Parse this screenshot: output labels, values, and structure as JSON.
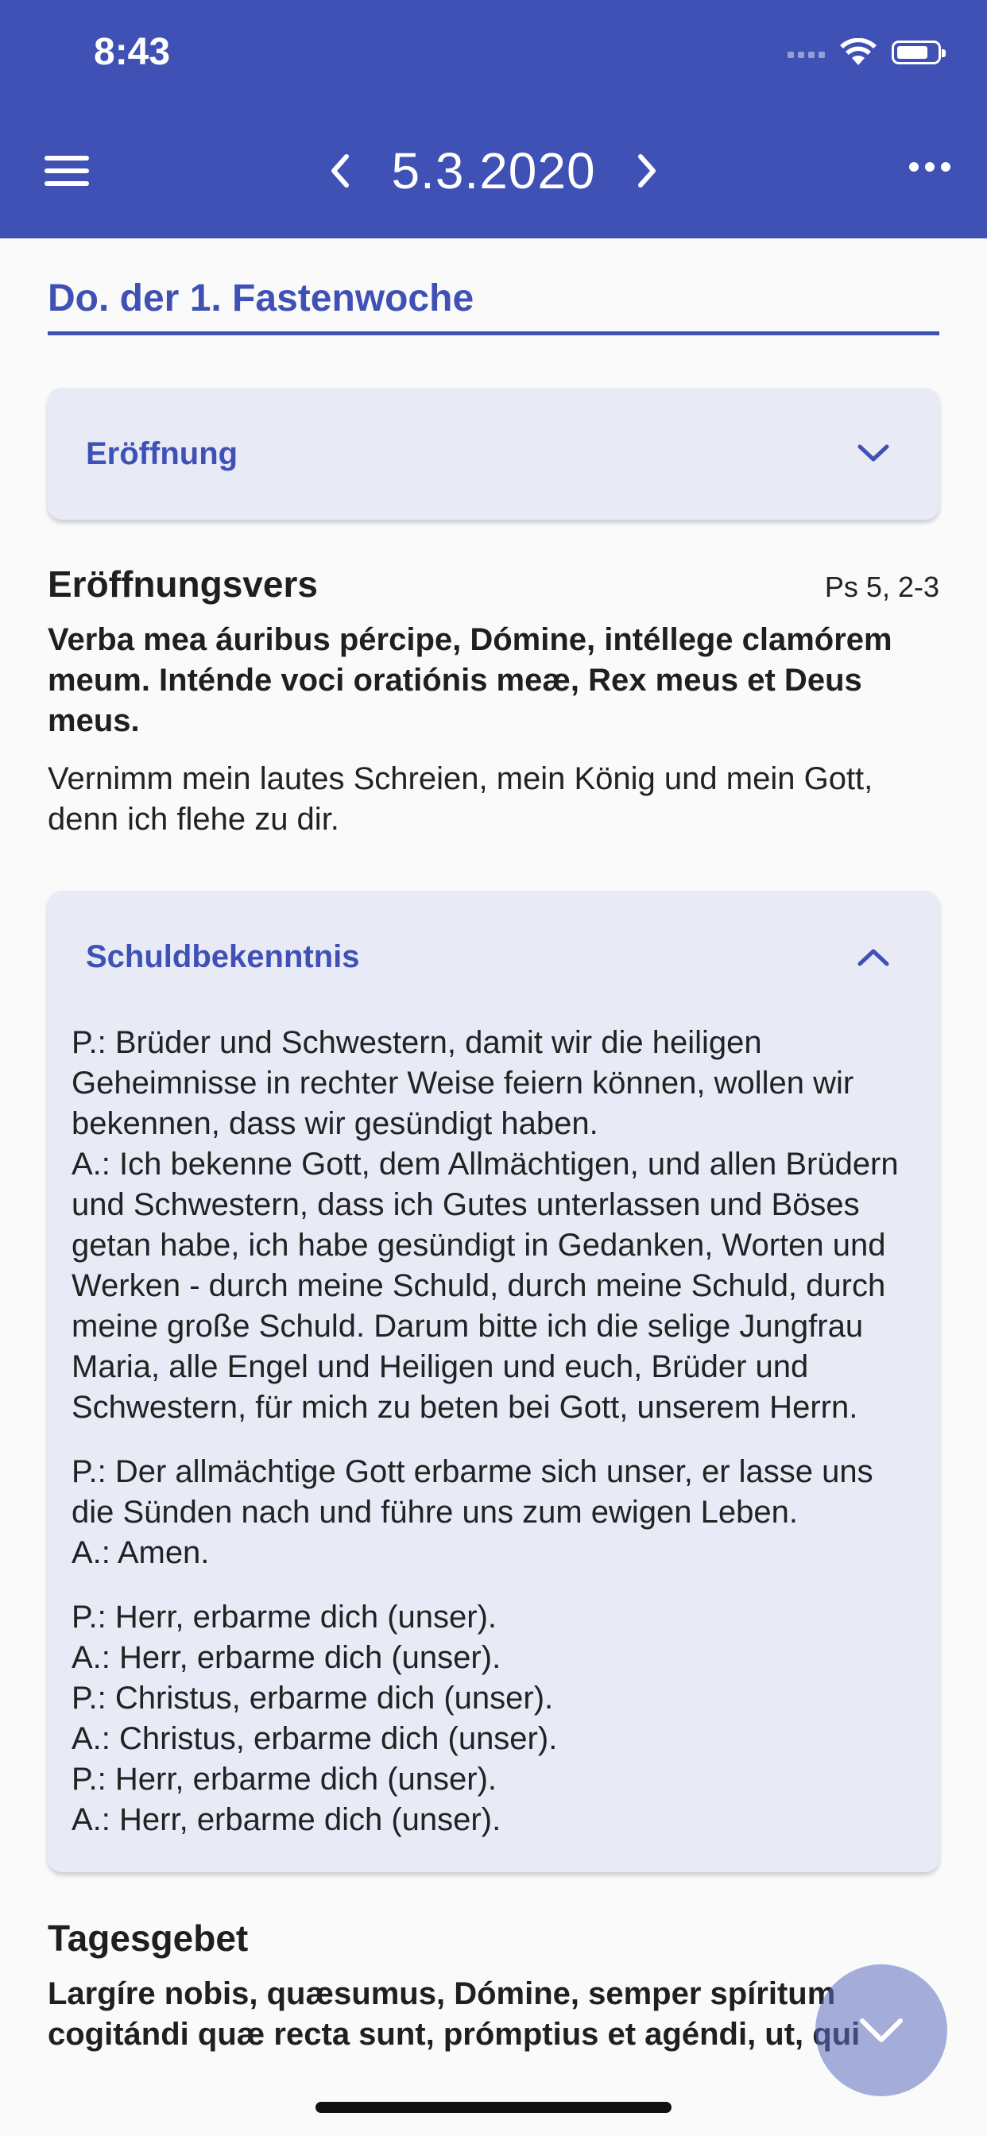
{
  "status_bar": {
    "time": "8:43"
  },
  "header": {
    "date": "5.3.2020"
  },
  "page": {
    "title": "Do. der 1. Fastenwoche"
  },
  "sections": {
    "eroeffnung": {
      "label": "Eröffnung",
      "state": "collapsed"
    },
    "eroeffnungsvers": {
      "title": "Eröffnungsvers",
      "reference": "Ps 5, 2-3",
      "latin": "Verba mea áuribus pércipe, Dómine, intéllege clamórem meum. Inténde voci oratiónis meæ, Rex meus et Deus meus.",
      "german": "Vernimm mein lautes Schreien, mein König und mein Gott, denn ich flehe zu dir."
    },
    "schuldbekenntnis": {
      "label": "Schuldbekenntnis",
      "state": "expanded",
      "paragraphs": [
        "P.: Brüder und Schwestern, damit wir die heiligen Geheimnisse in rechter Weise feiern können, wollen wir bekennen, dass wir gesündigt haben.\nA.: Ich bekenne Gott, dem Allmächtigen, und allen Brüdern und Schwestern, dass ich Gutes unterlassen und Böses getan habe, ich habe gesündigt in Gedanken, Worten und Werken - durch meine Schuld, durch meine Schuld, durch meine große Schuld. Darum bitte ich die selige Jungfrau Maria, alle Engel und Heiligen und euch, Brüder und Schwestern, für mich zu beten bei Gott, unserem Herrn.",
        "P.: Der allmächtige Gott erbarme sich unser, er lasse uns die Sünden nach und führe uns zum ewigen Leben.\nA.: Amen.",
        "P.: Herr, erbarme dich (unser).\nA.: Herr, erbarme dich (unser).\nP.: Christus, erbarme dich (unser).\nA.: Christus, erbarme dich (unser).\nP.: Herr, erbarme dich (unser).\nA.: Herr, erbarme dich (unser)."
      ]
    },
    "tagesgebet": {
      "title": "Tagesgebet",
      "latin": "Largíre nobis, quæsumus, Dómine, semper spíritum cogitándi quæ recta sunt, prómptius et agéndi, ut, qui"
    }
  },
  "colors": {
    "primary": "#3f51b5",
    "card": "#e8eaf6",
    "fab": "#8c96d6"
  },
  "icons": {
    "menu": "hamburger-menu-icon",
    "prev": "chevron-left-icon",
    "next": "chevron-right-icon",
    "more": "more-horizontal-icon",
    "expand": "chevron-down-icon",
    "collapse": "chevron-up-icon",
    "fab": "chevron-down-icon"
  }
}
